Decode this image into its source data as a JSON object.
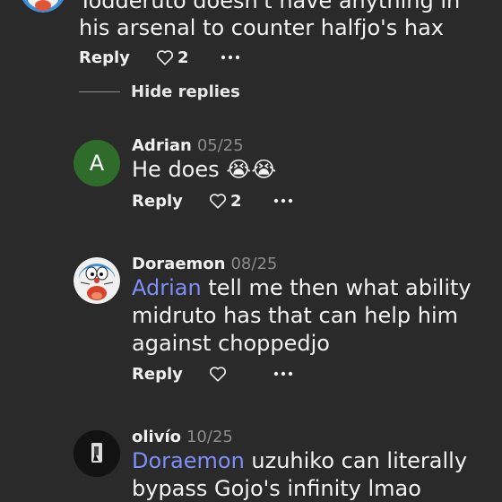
{
  "top_comment": {
    "line1": "Todderuto doesn't have anything in",
    "line2": "his arsenal to counter halfjo's hax",
    "reply_label": "Reply",
    "likes": "2"
  },
  "hide_replies_label": "Hide replies",
  "replies": [
    {
      "avatar_letter": "A",
      "username": "Adrian",
      "date": "05/25",
      "text": "He does 😭😭",
      "reply_label": "Reply",
      "likes": "2"
    },
    {
      "username": "Doraemon",
      "date": "08/25",
      "mention": "Adrian",
      "text_line1": " tell me then what ability",
      "text_line2": "midruto has that can help him",
      "text_line3": "against choppedjo",
      "reply_label": "Reply",
      "likes": ""
    },
    {
      "username": "olivío",
      "date": "10/25",
      "mention": "Doraemon",
      "text_line1": " uzuhiko can literally",
      "text_line2": "bypass Gojo's infinity lmao"
    }
  ],
  "colors": {
    "background": "#2a2a2a",
    "mention": "#7f8ef5",
    "avatar_green": "#2f6b2a",
    "date_gray": "#8c8c8c"
  },
  "icons": [
    "heart-outline-icon",
    "more-horizontal-icon"
  ]
}
